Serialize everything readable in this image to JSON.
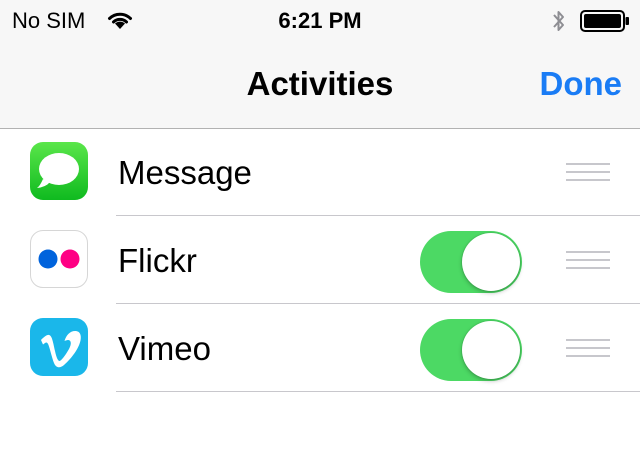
{
  "status_bar": {
    "carrier": "No SIM",
    "time": "6:21 PM",
    "icons": [
      "wifi-icon",
      "bluetooth-icon",
      "battery-icon"
    ]
  },
  "nav": {
    "title": "Activities",
    "done_label": "Done"
  },
  "colors": {
    "accent": "#1a7cf5",
    "toggle_on": "#4cd964",
    "separator": "#c8c7cc",
    "flickr_blue": "#0063dc",
    "flickr_pink": "#ff0084",
    "vimeo": "#1ab7ea"
  },
  "activities": [
    {
      "label": "Message",
      "icon": "messages-app-icon",
      "toggle_visible": false
    },
    {
      "label": "Flickr",
      "icon": "flickr-app-icon",
      "toggle_visible": true,
      "toggle_on": true
    },
    {
      "label": "Vimeo",
      "icon": "vimeo-app-icon",
      "toggle_visible": true,
      "toggle_on": true
    }
  ]
}
